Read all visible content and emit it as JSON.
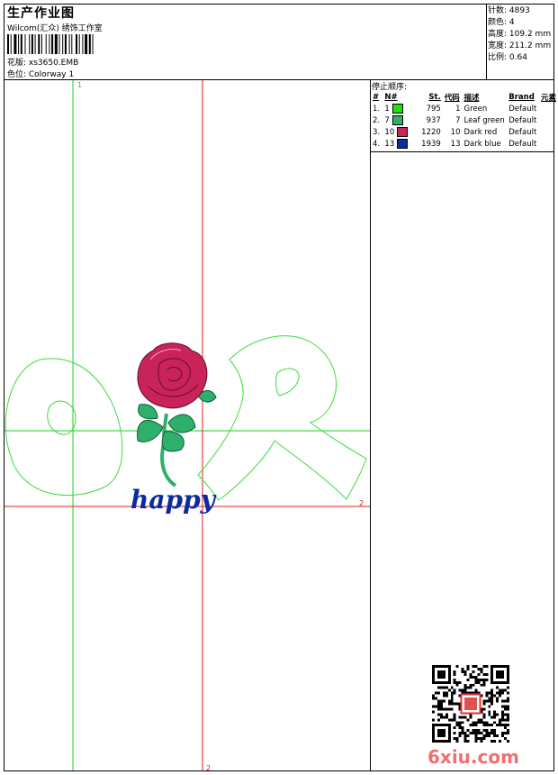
{
  "header": {
    "title": "生产作业图",
    "subtitle": "Wilcom(汇众) 绣饰工作室",
    "design_label": "花版: xs3650.EMB",
    "colorway_label": "色位:  Colorway 1"
  },
  "stats": [
    {
      "label": "针数:",
      "value": "4893"
    },
    {
      "label": "颜色:",
      "value": "4"
    },
    {
      "label": "高度:",
      "value": "109.2 mm"
    },
    {
      "label": "宽度:",
      "value": "211.2 mm"
    },
    {
      "label": "比例:",
      "value": "0.64"
    }
  ],
  "stop_sequence": {
    "heading": "停止顺序:",
    "columns": [
      "#",
      "N#",
      "St.",
      "代码",
      "描述",
      "Brand",
      "元素"
    ],
    "rows": [
      {
        "idx": "1.",
        "n": "1",
        "color": "#22e000",
        "st": "795",
        "code": "1",
        "desc": "Green",
        "brand": "Default"
      },
      {
        "idx": "2.",
        "n": "7",
        "color": "#2eb06a",
        "st": "937",
        "code": "7",
        "desc": "Leaf green",
        "brand": "Default"
      },
      {
        "idx": "3.",
        "n": "10",
        "color": "#c8245a",
        "st": "1220",
        "code": "10",
        "desc": "Dark red",
        "brand": "Default"
      },
      {
        "idx": "4.",
        "n": "13",
        "color": "#0a2aa0",
        "st": "1939",
        "code": "13",
        "desc": "Dark blue",
        "brand": "Default"
      }
    ]
  },
  "guides": {
    "green_top_mark": "1",
    "red_right_mark": "2",
    "red_bottom_mark": "2"
  },
  "design_text": "happy",
  "watermark": "6xiu.com",
  "colors": {
    "green_guide": "#22cc22",
    "red_guide": "#dd2222",
    "outline": "#3adc3a",
    "rose": "#c8245a",
    "leaf": "#2eb06a",
    "text_blue": "#0a2aa0"
  }
}
